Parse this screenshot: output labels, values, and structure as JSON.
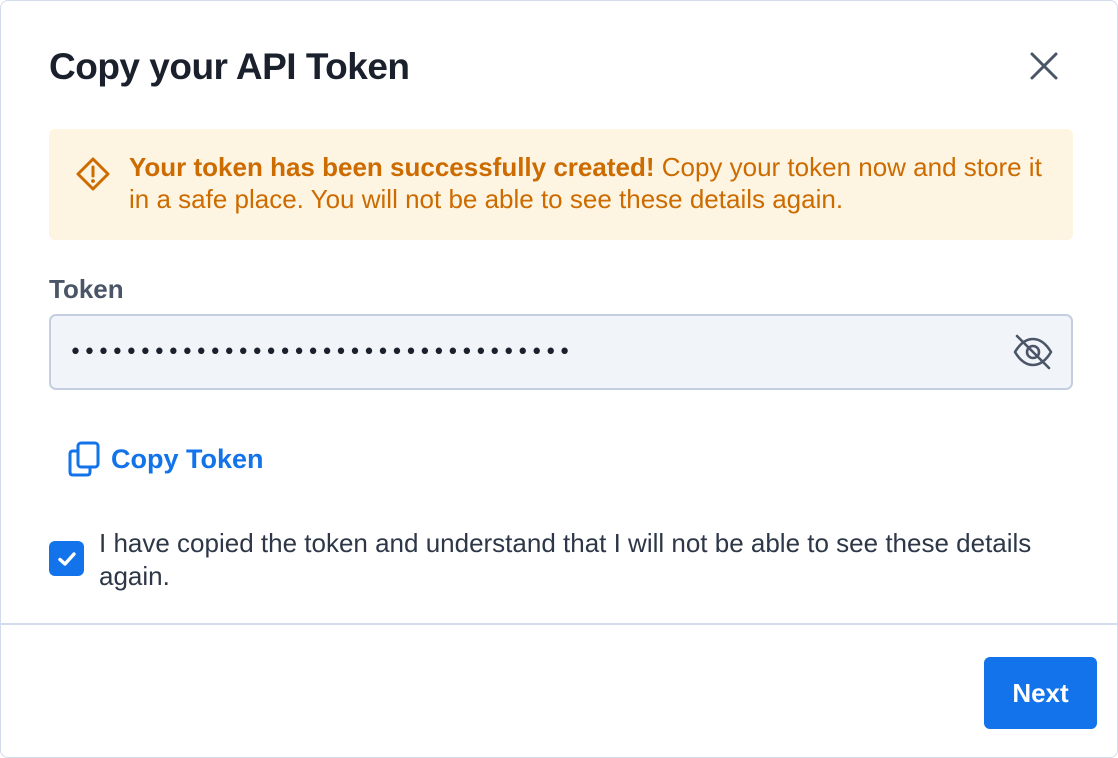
{
  "dialog": {
    "title": "Copy your API Token",
    "close_icon": "close-icon"
  },
  "alert": {
    "icon": "warning-diamond-icon",
    "strong_text": "Your token has been successfully created!",
    "body_text": " Copy your token now and store it in a safe place. You will not be able to see these details again."
  },
  "token_field": {
    "label": "Token",
    "masked_value": "••••••••••••••••••••••••••••••••••••",
    "visibility_icon": "eye-off-icon"
  },
  "copy_action": {
    "icon": "copy-icon",
    "label": "Copy Token"
  },
  "acknowledgement": {
    "checked": true,
    "label": "I have copied the token and understand that I will not be able to see these details again."
  },
  "footer": {
    "next_label": "Next"
  },
  "colors": {
    "accent": "#1273eb",
    "warning_text": "#cc6b00",
    "warning_bg": "#fef4e2",
    "title": "#1a202c",
    "input_bg": "#f1f5f9",
    "border": "#d3dcea"
  }
}
